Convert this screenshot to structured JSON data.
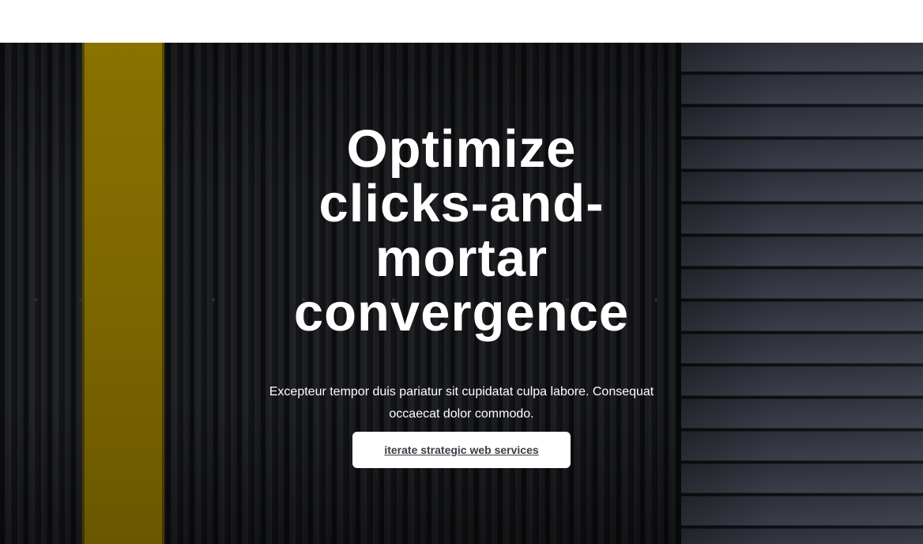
{
  "hero": {
    "headline": "Optimize clicks-and-mortar convergence",
    "subtext": "Excepteur tempor duis pariatur sit cupidatat culpa labore. Consequat occaecat dolor commodo.",
    "cta_label": "iterate strategic web services"
  },
  "colors": {
    "accent_stripe": "#8a7200",
    "text": "#ffffff",
    "button_bg": "#ffffff",
    "button_text": "#3a3d44"
  }
}
